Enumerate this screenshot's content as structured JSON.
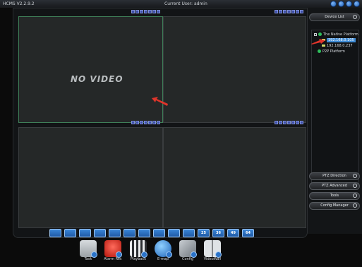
{
  "window": {
    "title": "HCMS V2.2.9.2",
    "current_user": "Current User: admin"
  },
  "video": {
    "no_video_text": "NO VIDEO"
  },
  "layout_buttons": [
    "",
    "",
    "",
    "",
    "",
    "",
    "",
    "",
    "",
    "",
    "25",
    "36",
    "49",
    "64"
  ],
  "sidebar": {
    "device_list": "Device List",
    "tree": {
      "root": "The Native Platform",
      "devices": [
        "192.168.0.105",
        "192.168.0.237"
      ],
      "p2p": "P2P Platform"
    },
    "ptz_direction": "PTZ Direction",
    "ptz_advanced": "PTZ Advanced",
    "tools": "Tools",
    "config_manager": "Config Manager"
  },
  "dock": {
    "items": [
      "Task",
      "Alarm Rec",
      "Playback",
      "E-map",
      "Config",
      "VideoWall"
    ]
  }
}
